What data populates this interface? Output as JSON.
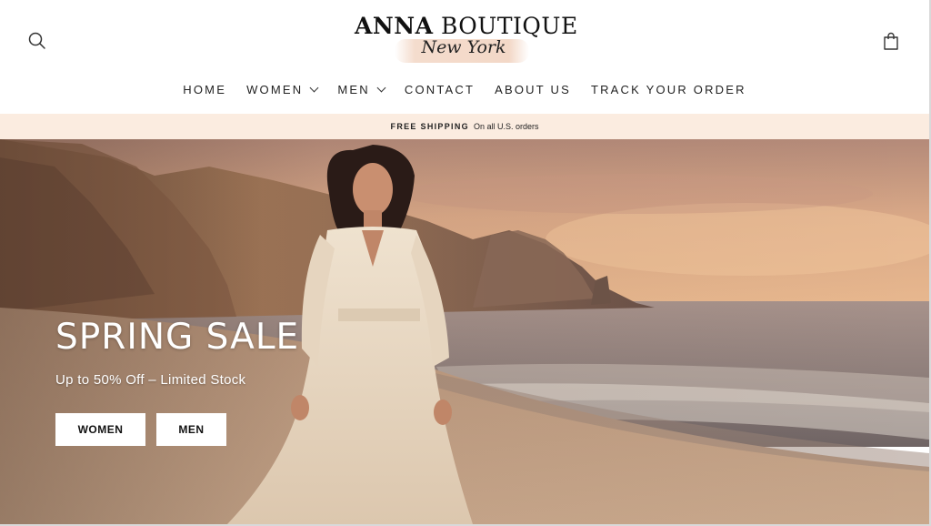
{
  "brand": {
    "name_bold": "ANNA",
    "name_light": "BOUTIQUE",
    "subtitle": "New York"
  },
  "header": {
    "search_icon": "search-icon",
    "cart_icon": "shopping-bag-icon"
  },
  "nav": {
    "items": [
      {
        "label": "HOME",
        "has_dropdown": false
      },
      {
        "label": "WOMEN",
        "has_dropdown": true
      },
      {
        "label": "MEN",
        "has_dropdown": true
      },
      {
        "label": "CONTACT",
        "has_dropdown": false
      },
      {
        "label": "ABOUT US",
        "has_dropdown": false
      },
      {
        "label": "TRACK YOUR ORDER",
        "has_dropdown": false
      }
    ]
  },
  "announcement": {
    "bold": "FREE SHIPPING",
    "text": "On all U.S. orders"
  },
  "hero": {
    "title": "SPRING SALE",
    "subtitle": "Up to 50% Off – Limited Stock",
    "buttons": {
      "women": "WOMEN",
      "men": "MEN"
    }
  },
  "colors": {
    "announcement_bg": "#fbece0",
    "logo_swash": "#f3d8c7",
    "text_dark": "#222222"
  }
}
